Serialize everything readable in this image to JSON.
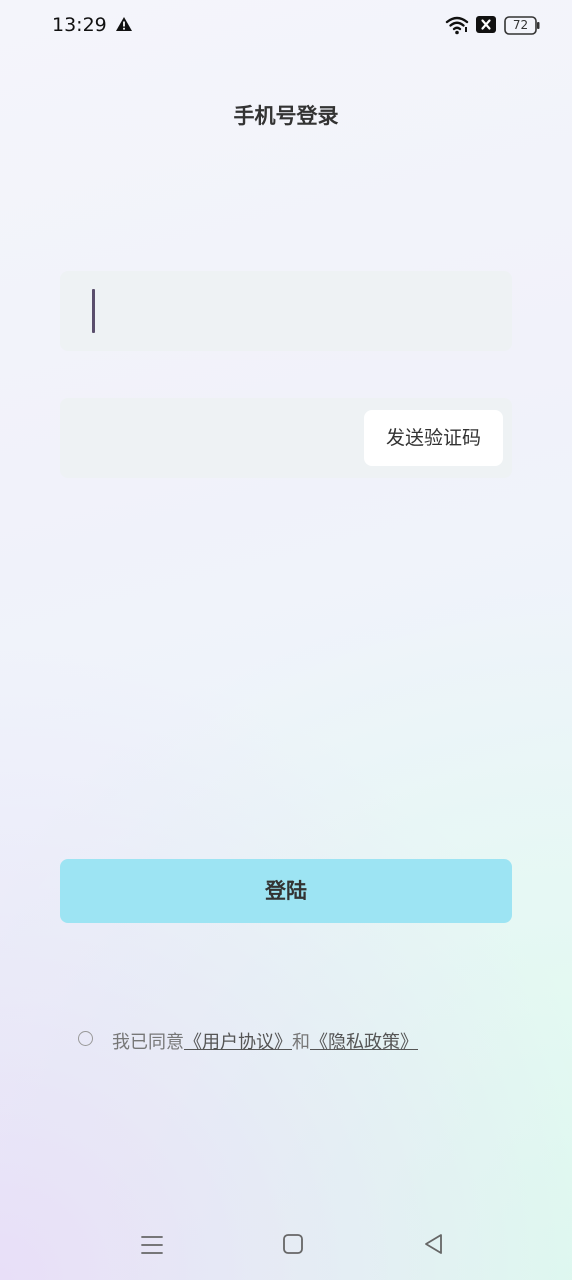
{
  "status_bar": {
    "time": "13:29",
    "battery_level": "72",
    "icons": [
      "warning-icon",
      "wifi-icon",
      "sim-x-icon",
      "battery-icon"
    ]
  },
  "title": "手机号登录",
  "phone_field": {
    "value": "",
    "placeholder": ""
  },
  "code_field": {
    "value": "",
    "placeholder": ""
  },
  "send_code_label": "发送验证码",
  "login_label": "登陆",
  "agreement": {
    "prefix": "我已同意",
    "user_agreement": "《用户协议》",
    "conjunction": "和",
    "privacy_policy": "《隐私政策》",
    "checked": false
  },
  "nav_bar": {
    "icons": [
      "menu-icon",
      "home-icon",
      "back-icon"
    ]
  },
  "colors": {
    "login_button": "#9de4f3",
    "field_background": "#eef2f4",
    "caret": "#5a4e6c"
  }
}
